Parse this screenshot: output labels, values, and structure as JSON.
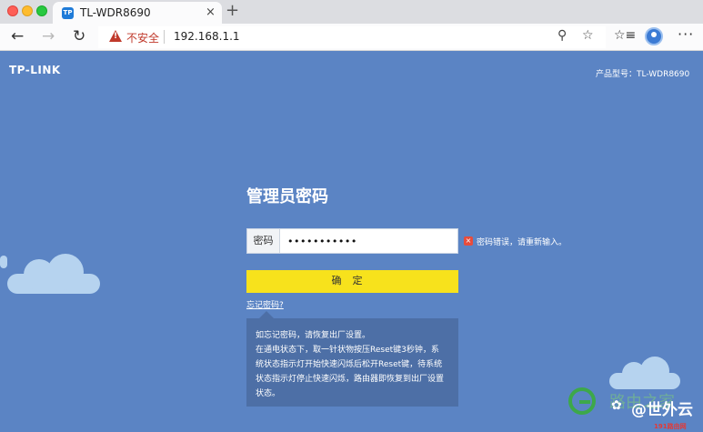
{
  "browser": {
    "tab": {
      "favicon": "TP",
      "title": "TL-WDR8690",
      "close": "×"
    },
    "new_tab": "+",
    "nav": {
      "back": "←",
      "forward": "→",
      "reload": "↻"
    },
    "address": {
      "security_label": "不安全",
      "url": "192.168.1.1"
    },
    "icons": {
      "zoom": "⚲",
      "star": "☆",
      "favorites": "☆≡",
      "more": "···"
    }
  },
  "page": {
    "logo": "TP-LINK",
    "model": "产品型号：TL-WDR8690",
    "title": "管理员密码",
    "password": {
      "label": "密码",
      "value": "•••••••••••"
    },
    "error": {
      "icon": "×",
      "message": "密码错误，请重新输入。"
    },
    "confirm_button": "确定",
    "forgot_link": "忘记密码?",
    "info_lines": [
      "如忘记密码，请恢复出厂设置。",
      "在通电状态下，取一针状物按压Reset键3秒钟，系",
      "统状态指示灯开始快速闪烁后松开Reset键，待系统",
      "状态指示灯停止快速闪烁，路由器即恢复到出厂设置",
      "状态。"
    ]
  },
  "watermark": {
    "faded_text": "路由之家",
    "weixin_icon": "✿",
    "main": "@世外云",
    "sub": "191路由网"
  },
  "colors": {
    "page_background": "#5b84c4",
    "confirm_button": "#f7e21c",
    "error": "#e74c3c",
    "insecure": "#c0392b"
  }
}
